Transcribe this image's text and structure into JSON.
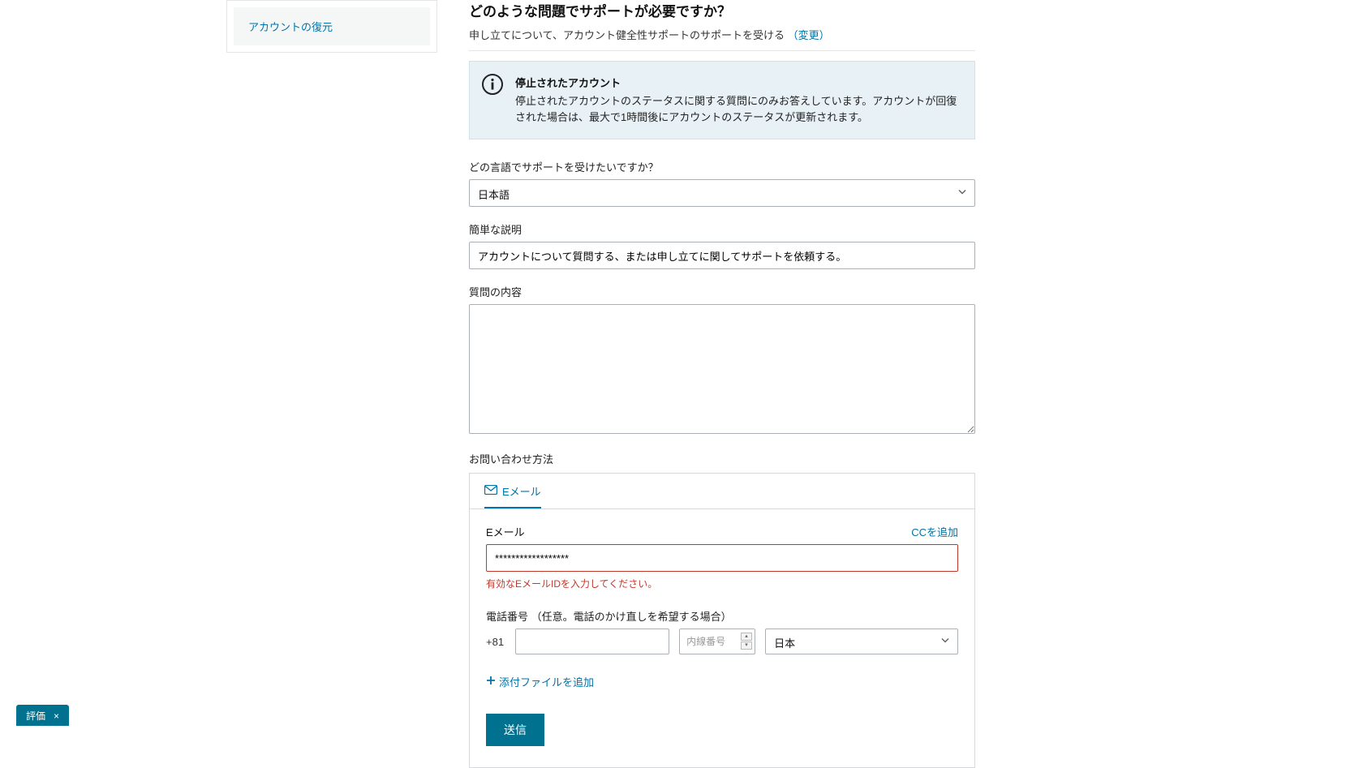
{
  "sidebar": {
    "items": [
      {
        "label": "アカウントの復元"
      }
    ]
  },
  "main": {
    "heading": "どのような問題でサポートが必要ですか？",
    "subtitle_prefix": "申し立てについて、アカウント健全性サポートのサポートを受ける ",
    "change_link": "（変更）",
    "notice": {
      "title": "停止されたアカウント",
      "body": "停止されたアカウントのステータスに関する質問にのみお答えしています。アカウントが回復された場合は、最大で1時間後にアカウントのステータスが更新されます。"
    },
    "language": {
      "label": "どの言語でサポートを受けたいですか？",
      "selected": "日本語"
    },
    "brief": {
      "label": "簡単な説明",
      "value": "アカウントについて質問する、または申し立てに関してサポートを依頼する。"
    },
    "details": {
      "label": "質問の内容",
      "value": ""
    },
    "contact": {
      "label": "お問い合わせ方法",
      "tab_email": "Eメール",
      "email_field_label": "Eメール",
      "cc_link": "CCを追加",
      "email_value": "******************",
      "email_error": "有効なEメールIDを入力してください。",
      "phone_label": "電話番号 （任意。電話のかけ直しを希望する場合）",
      "phone_prefix": "+81",
      "phone_value": "",
      "ext_placeholder": "内線番号",
      "country_selected": "日本",
      "attach_link": "添付ファイルを追加",
      "submit": "送信"
    }
  },
  "feedback_tab": {
    "label": "評価",
    "close": "×"
  }
}
